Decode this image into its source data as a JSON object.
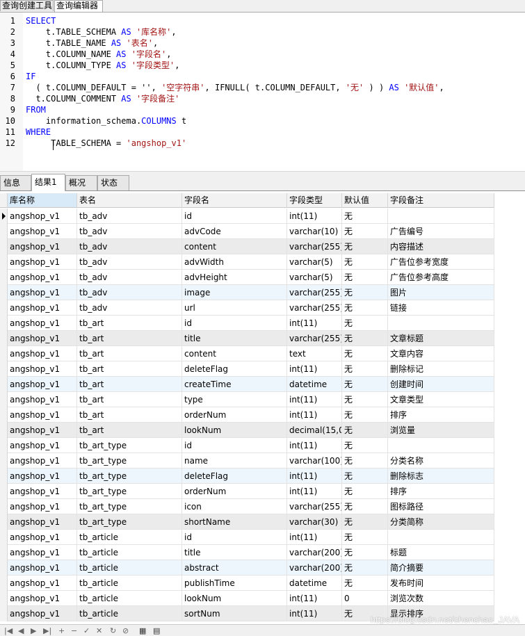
{
  "top_tabs": [
    "查询创建工具",
    "查询编辑器"
  ],
  "editor": {
    "line_numbers": [
      "1",
      "2",
      "3",
      "4",
      "5",
      "6",
      "7",
      "8",
      "9",
      "10",
      "11",
      "12"
    ],
    "lines": [
      [
        {
          "t": "SELECT",
          "c": "kw"
        }
      ],
      [
        {
          "t": "    t.TABLE_SCHEMA ",
          "c": ""
        },
        {
          "t": "AS",
          "c": "kw"
        },
        {
          "t": " '库名称'",
          "c": "str"
        },
        {
          "t": ",",
          "c": ""
        }
      ],
      [
        {
          "t": "    t.TABLE_NAME ",
          "c": ""
        },
        {
          "t": "AS",
          "c": "kw"
        },
        {
          "t": " '表名'",
          "c": "str"
        },
        {
          "t": ",",
          "c": ""
        }
      ],
      [
        {
          "t": "    t.COLUMN_NAME ",
          "c": ""
        },
        {
          "t": "AS",
          "c": "kw"
        },
        {
          "t": " '字段名'",
          "c": "str"
        },
        {
          "t": ",",
          "c": ""
        }
      ],
      [
        {
          "t": "    t.COLUMN_TYPE ",
          "c": ""
        },
        {
          "t": "AS",
          "c": "kw"
        },
        {
          "t": " '字段类型'",
          "c": "str"
        },
        {
          "t": ",",
          "c": ""
        }
      ],
      [
        {
          "t": "IF",
          "c": "kw"
        }
      ],
      [
        {
          "t": "  ( t.COLUMN_DEFAULT = '', ",
          "c": ""
        },
        {
          "t": "'空字符串'",
          "c": "str"
        },
        {
          "t": ", IFNULL( t.COLUMN_DEFAULT, ",
          "c": ""
        },
        {
          "t": "'无'",
          "c": "str"
        },
        {
          "t": " ) ) ",
          "c": ""
        },
        {
          "t": "AS",
          "c": "kw"
        },
        {
          "t": " '默认值'",
          "c": "str"
        },
        {
          "t": ",",
          "c": ""
        }
      ],
      [
        {
          "t": "  t.COLUMN_COMMENT ",
          "c": ""
        },
        {
          "t": "AS",
          "c": "kw"
        },
        {
          "t": " '字段备注'",
          "c": "str"
        }
      ],
      [
        {
          "t": "FROM",
          "c": "kw"
        }
      ],
      [
        {
          "t": "    information_schema.",
          "c": ""
        },
        {
          "t": "COLUMNS",
          "c": "kw"
        },
        {
          "t": " t",
          "c": ""
        }
      ],
      [
        {
          "t": "WHERE",
          "c": "kw"
        }
      ],
      [
        {
          "t": "     TABLE_SCHEMA = ",
          "c": ""
        },
        {
          "t": "'angshop_v1'",
          "c": "str"
        }
      ]
    ]
  },
  "result_tabs": [
    "信息",
    "结果1",
    "概况",
    "状态"
  ],
  "active_result_tab": 1,
  "grid": {
    "columns": [
      "库名称",
      "表名",
      "字段名",
      "字段类型",
      "默认值",
      "字段备注"
    ],
    "rows": [
      [
        "angshop_v1",
        "tb_adv",
        "id",
        "int(11)",
        "无",
        ""
      ],
      [
        "angshop_v1",
        "tb_adv",
        "advCode",
        "varchar(10)",
        "无",
        "广告编号"
      ],
      [
        "angshop_v1",
        "tb_adv",
        "content",
        "varchar(255)",
        "无",
        "内容描述"
      ],
      [
        "angshop_v1",
        "tb_adv",
        "advWidth",
        "varchar(5)",
        "无",
        "广告位参考宽度"
      ],
      [
        "angshop_v1",
        "tb_adv",
        "advHeight",
        "varchar(5)",
        "无",
        "广告位参考高度"
      ],
      [
        "angshop_v1",
        "tb_adv",
        "image",
        "varchar(255)",
        "无",
        "图片"
      ],
      [
        "angshop_v1",
        "tb_adv",
        "url",
        "varchar(255)",
        "无",
        "链接"
      ],
      [
        "angshop_v1",
        "tb_art",
        "id",
        "int(11)",
        "无",
        ""
      ],
      [
        "angshop_v1",
        "tb_art",
        "title",
        "varchar(255)",
        "无",
        "文章标题"
      ],
      [
        "angshop_v1",
        "tb_art",
        "content",
        "text",
        "无",
        "文章内容"
      ],
      [
        "angshop_v1",
        "tb_art",
        "deleteFlag",
        "int(11)",
        "无",
        "删除标记"
      ],
      [
        "angshop_v1",
        "tb_art",
        "createTime",
        "datetime",
        "无",
        "创建时间"
      ],
      [
        "angshop_v1",
        "tb_art",
        "type",
        "int(11)",
        "无",
        "文章类型"
      ],
      [
        "angshop_v1",
        "tb_art",
        "orderNum",
        "int(11)",
        "无",
        "排序"
      ],
      [
        "angshop_v1",
        "tb_art",
        "lookNum",
        "decimal(15,0",
        "无",
        "浏览量"
      ],
      [
        "angshop_v1",
        "tb_art_type",
        "id",
        "int(11)",
        "无",
        ""
      ],
      [
        "angshop_v1",
        "tb_art_type",
        "name",
        "varchar(100)",
        "无",
        "分类名称"
      ],
      [
        "angshop_v1",
        "tb_art_type",
        "deleteFlag",
        "int(11)",
        "无",
        "删除标志"
      ],
      [
        "angshop_v1",
        "tb_art_type",
        "orderNum",
        "int(11)",
        "无",
        "排序"
      ],
      [
        "angshop_v1",
        "tb_art_type",
        "icon",
        "varchar(255)",
        "无",
        "图标路径"
      ],
      [
        "angshop_v1",
        "tb_art_type",
        "shortName",
        "varchar(30)",
        "无",
        "分类简称"
      ],
      [
        "angshop_v1",
        "tb_article",
        "id",
        "int(11)",
        "无",
        ""
      ],
      [
        "angshop_v1",
        "tb_article",
        "title",
        "varchar(200)",
        "无",
        "标题"
      ],
      [
        "angshop_v1",
        "tb_article",
        "abstract",
        "varchar(200)",
        "无",
        "简介摘要"
      ],
      [
        "angshop_v1",
        "tb_article",
        "publishTime",
        "datetime",
        "无",
        "发布时间"
      ],
      [
        "angshop_v1",
        "tb_article",
        "lookNum",
        "int(11)",
        "0",
        "浏览次数"
      ],
      [
        "angshop_v1",
        "tb_article",
        "sortNum",
        "int(11)",
        "无",
        "显示排序"
      ]
    ],
    "row_colors": [
      "#ffffff",
      "#ffffff",
      "#ebebeb",
      "#ffffff",
      "#ffffff",
      "#eef6fd",
      "#ffffff",
      "#ffffff",
      "#ebebeb",
      "#ffffff",
      "#ffffff",
      "#eef6fd",
      "#ffffff",
      "#ffffff",
      "#ebebeb",
      "#ffffff",
      "#ffffff",
      "#eef6fd",
      "#ffffff",
      "#ffffff",
      "#ebebeb",
      "#ffffff",
      "#ffffff",
      "#eef6fd",
      "#ffffff",
      "#ffffff",
      "#ebebeb"
    ]
  },
  "watermark": "https://blog.csdn.net/chenchao_JAVA"
}
